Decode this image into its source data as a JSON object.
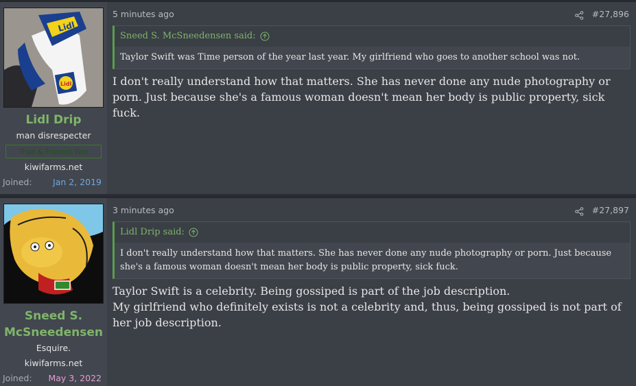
{
  "posts": [
    {
      "user": {
        "name": "Lidl Drip",
        "title": "man disrespecter",
        "banner": "True & Honest Fan",
        "site": "kiwifarms.net",
        "joined_label": "Joined:",
        "joined_date": "Jan 2, 2019"
      },
      "time": "5 minutes ago",
      "number": "#27,896",
      "quote": {
        "author": "Sneed S. McSneedensen said:",
        "text": "Taylor Swift was Time person of the year last year. My girlfriend who goes to another school was not."
      },
      "message": [
        "I don't really understand how that matters. She has never done any nude photography or porn. Just because she's a famous woman doesn't mean her body is public property, sick fuck."
      ]
    },
    {
      "user": {
        "name": "Sneed S. McSneedensen",
        "title": "Esquire.",
        "site": "kiwifarms.net",
        "joined_label": "Joined:",
        "joined_date": "May 3, 2022"
      },
      "time": "3 minutes ago",
      "number": "#27,897",
      "quote": {
        "author": "Lidl Drip said:",
        "text": "I don't really understand how that matters. She has never done any nude photography or porn. Just because she's a famous woman doesn't mean her body is public property, sick fuck."
      },
      "message": [
        "Taylor Swift is a celebrity. Being gossiped is part of the job description.",
        "My girlfriend who definitely exists is not a celebrity and, thus, being gossiped is not part of her job description."
      ]
    }
  ],
  "icons": {
    "share": "share-icon",
    "quote_jump": "arrow-up-circle-icon"
  },
  "colors": {
    "username": "#7fb56a",
    "quote_border": "#5b9e4e",
    "joined_blue": "#6fa8e0",
    "joined_pink": "#e89bd6"
  }
}
